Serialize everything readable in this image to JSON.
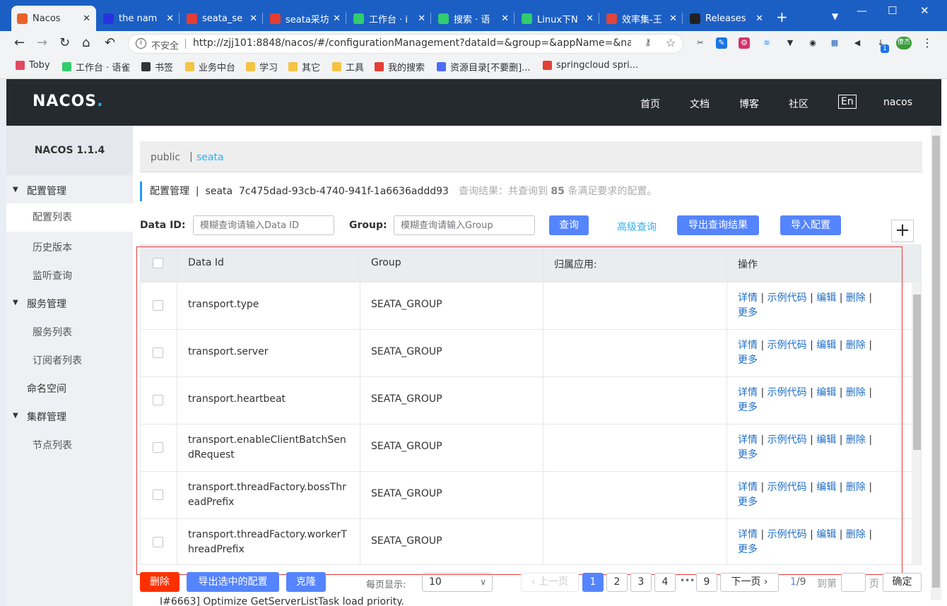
{
  "browser": {
    "tabs": [
      {
        "title": "Nacos",
        "active": true,
        "icon": "nacos-favicon",
        "color": "#e8632b"
      },
      {
        "title": "the nam",
        "icon": "baidu-favicon",
        "color": "#2932e1"
      },
      {
        "title": "seata_se",
        "icon": "csdn-favicon",
        "color": "#e33e33"
      },
      {
        "title": "seata采坊",
        "icon": "csdn-favicon",
        "color": "#e33e33"
      },
      {
        "title": "工作台 · i",
        "icon": "yuque-favicon",
        "color": "#31cc6e"
      },
      {
        "title": "搜索 · 语",
        "icon": "yuque-favicon",
        "color": "#31cc6e"
      },
      {
        "title": "Linux下N",
        "icon": "yuque-favicon",
        "color": "#31cc6e"
      },
      {
        "title": "效率集-王",
        "icon": "app-favicon",
        "color": "#e0453c"
      },
      {
        "title": "Releases",
        "icon": "github-favicon",
        "color": "#222222"
      }
    ],
    "address": {
      "security": "不安全",
      "url": "http://zjj101:8848/nacos/#/configurationManagement?dataId=&group=&appName=&na..."
    },
    "extensions": [
      "scissors-icon",
      "edit-icon",
      "extension-icon",
      "wifi-icon",
      "vpn-icon",
      "owl-icon",
      "grid-icon",
      "speaker-icon",
      "download-icon"
    ],
    "download_badge": "1",
    "profile": "傻杰",
    "bookmarks": [
      {
        "label": "Toby",
        "color": "#e04b5e"
      },
      {
        "label": "工作台 · 语雀",
        "color": "#31cc6e"
      },
      {
        "label": "书签",
        "color": "#333333"
      },
      {
        "label": "业务中台",
        "color": "#f5c344"
      },
      {
        "label": "学习",
        "color": "#f5c344"
      },
      {
        "label": "其它",
        "color": "#f5c344"
      },
      {
        "label": "工具",
        "color": "#f5c344"
      },
      {
        "label": "我的搜索",
        "color": "#e33e33"
      },
      {
        "label": "资源目录[不要删]...",
        "color": "#4a6cf7"
      },
      {
        "label": "springcloud spri...",
        "color": "#e33e33"
      }
    ]
  },
  "header": {
    "logo": "NACOS",
    "logo_dot": ".",
    "nav": [
      "首页",
      "文档",
      "博客",
      "社区"
    ],
    "lang": "En",
    "user": "nacos"
  },
  "sidebar": {
    "version": "NACOS 1.1.4",
    "groups": [
      {
        "label": "配置管理",
        "items": [
          "配置列表",
          "历史版本",
          "监听查询"
        ]
      },
      {
        "label": "服务管理",
        "items": [
          "服务列表",
          "订阅者列表"
        ]
      },
      {
        "label": "命名空间",
        "items": []
      },
      {
        "label": "集群管理",
        "items": [
          "节点列表"
        ]
      }
    ]
  },
  "namespace": {
    "public": "public",
    "separator": "|",
    "current": "seata"
  },
  "breadcrumb": {
    "title": "配置管理",
    "separator": "|",
    "ns": "seata",
    "ns_id": "7c475dad-93cb-4740-941f-1a6636addd93",
    "result_prefix": "查询结果：共查询到",
    "count": "85",
    "result_suffix": "条满足要求的配置。"
  },
  "filters": {
    "dataid_label": "Data ID:",
    "dataid_placeholder": "模糊查询请输入Data ID",
    "group_label": "Group:",
    "group_placeholder": "模糊查询请输入Group",
    "query": "查询",
    "advanced": "高级查询",
    "export_result": "导出查询结果",
    "import": "导入配置"
  },
  "table": {
    "columns": [
      "Data Id",
      "Group",
      "归属应用:",
      "操作"
    ],
    "actions": [
      "详情",
      "示例代码",
      "编辑",
      "删除",
      "更多"
    ],
    "rows": [
      {
        "dataId": "transport.type",
        "group": "SEATA_GROUP",
        "app": ""
      },
      {
        "dataId": "transport.server",
        "group": "SEATA_GROUP",
        "app": ""
      },
      {
        "dataId": "transport.heartbeat",
        "group": "SEATA_GROUP",
        "app": ""
      },
      {
        "dataId": "transport.enableClientBatchSendRequest",
        "group": "SEATA_GROUP",
        "app": ""
      },
      {
        "dataId": "transport.threadFactory.bossThreadPrefix",
        "group": "SEATA_GROUP",
        "app": ""
      },
      {
        "dataId": "transport.threadFactory.workerThreadPrefix",
        "group": "SEATA_GROUP",
        "app": ""
      }
    ]
  },
  "footer": {
    "delete": "删除",
    "export_selected": "导出选中的配置",
    "clone": "克隆",
    "per_page_label": "每页显示:",
    "per_page": "10",
    "prev": "上一页",
    "pages": [
      "1",
      "2",
      "3",
      "4"
    ],
    "ellipsis": "•••",
    "last_page": "9",
    "next": "下一页",
    "current": "1",
    "total": "/9",
    "goto_label": "到第",
    "page_unit": "页",
    "confirm": "确定"
  },
  "background_text": "I#6663] Optimize GetServerListTask load priority."
}
